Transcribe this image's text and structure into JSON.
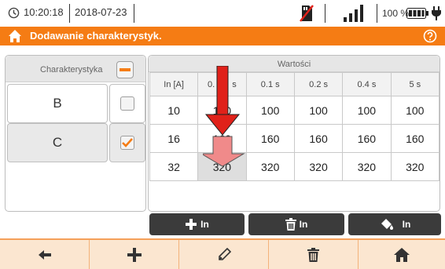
{
  "status_bar": {
    "time": "10:20:18",
    "date": "2018-07-23",
    "battery_percent": "100 %",
    "icons": [
      "clock-icon",
      "no-memory-card-icon",
      "signal-bars-icon",
      "battery-icon",
      "power-plug-icon"
    ]
  },
  "title_bar": {
    "title": "Dodawanie charakterystyk.",
    "icons": [
      "home-icon",
      "help-icon"
    ]
  },
  "characteristics": {
    "header": "Charakterystyka",
    "items": [
      {
        "label": "B",
        "checked": false
      },
      {
        "label": "C",
        "checked": true
      }
    ]
  },
  "values": {
    "header": "Wartości",
    "columns": [
      "In [A]",
      "0.01 s",
      "0.1 s",
      "0.2 s",
      "0.4 s",
      "5 s"
    ],
    "visible_column_fragments": {
      "left": "0.",
      "right": "s"
    },
    "rows": [
      [
        "10",
        "100",
        "100",
        "100",
        "100",
        "100"
      ],
      [
        "16",
        "160",
        "160",
        "160",
        "160",
        "160"
      ],
      [
        "32",
        "320",
        "320",
        "320",
        "320",
        "320"
      ]
    ]
  },
  "actions": {
    "add_in": "In",
    "delete_in": "In",
    "fill_in": "In"
  },
  "bottom_nav": [
    "back-icon",
    "plus-icon",
    "pencil-icon",
    "trash-icon",
    "home-icon"
  ],
  "colors": {
    "accent": "#f57c14",
    "arrow": "#e0211a"
  }
}
